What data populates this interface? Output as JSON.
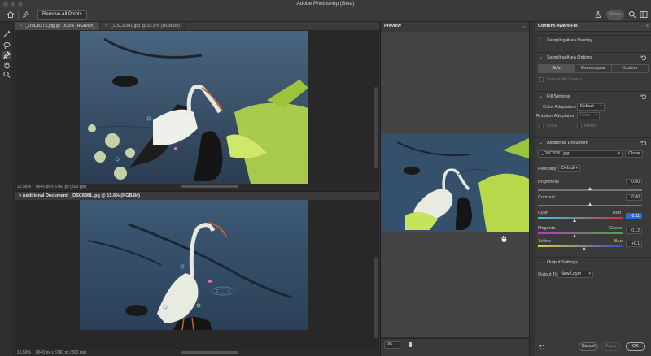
{
  "app": {
    "title": "Adobe Photoshop (Beta)"
  },
  "options_bar": {
    "remove_all_points": "Remove All Points",
    "share": "Share",
    "home_icon": "home-icon",
    "pin_icon": "pin-icon",
    "search_icon": "search-icon"
  },
  "tabs": [
    {
      "label": "_DSC8372.jpg @ 15.6% (RGB/8#)",
      "close": "×",
      "active": true
    },
    {
      "label": "_DSC8381.jpg @ 32.8% (RGB/8#)",
      "close": "×",
      "active": false
    }
  ],
  "top_status": {
    "zoom": "15.56%",
    "dims": "8640 px x 5760 px (300 ppi)"
  },
  "additional_document_bar": {
    "close": "×",
    "label": "Additional Document: _DSC8381.jpg @ 15.6% (RGB/8#)"
  },
  "bottom_status": {
    "zoom": "15.59%",
    "dims": "8640 px x 5760 px (300 ppi)"
  },
  "preview": {
    "title": "Preview",
    "zoom": "9%",
    "zoom_fraction": 0.03,
    "grip": "≡"
  },
  "content_aware_fill": {
    "title": "Content-Aware Fill",
    "grip": "≡",
    "sampling_area_overlay": {
      "label": "Sampling Area Overlay",
      "chevron": "›"
    },
    "sampling_area_options": {
      "label": "Sampling Area Options",
      "chevron": "⌄",
      "modes": [
        "Auto",
        "Rectangular",
        "Custom"
      ],
      "selected_mode": "Auto",
      "sample_all_layers": "Sample All Layers"
    },
    "fill_settings": {
      "label": "Fill Settings",
      "chevron": "⌄",
      "color_adaptation_label": "Color Adaptation",
      "color_adaptation_value": "Default",
      "rotation_adaptation_label": "Rotation Adaptation",
      "rotation_adaptation_value": "None",
      "scale": "Scale",
      "mirror": "Mirror"
    },
    "additional_document": {
      "label": "Additional Document",
      "chevron": "⌄",
      "file": "_DSC8381.jpg",
      "close": "Close",
      "flexibility_label": "Flexibility",
      "flexibility_value": "Default",
      "brightness_label": "Brightness",
      "brightness_value": "0.00",
      "brightness_fraction": 0.5,
      "contrast_label": "Contrast",
      "contrast_value": "0.00",
      "contrast_fraction": 0.5,
      "cyan_label": "Cyan",
      "red_label": "Red",
      "cyan_red_value": "-0.11",
      "cyan_red_fraction": 0.44,
      "magenta_label": "Magenta",
      "green_label": "Green",
      "magenta_green_value": "-0.12",
      "magenta_green_fraction": 0.44,
      "yellow_label": "Yellow",
      "blue_label": "Blue",
      "yellow_blue_value": "+0.1",
      "yellow_blue_fraction": 0.55
    },
    "output_settings": {
      "label": "Output Settings",
      "chevron": "⌄",
      "output_to_label": "Output To",
      "output_to_value": "New Layer"
    },
    "buttons": {
      "cancel": "Cancel",
      "apply": "Apply",
      "ok": "OK"
    }
  },
  "colors": {
    "accent": "#2a6ad4",
    "panel": "#3a3a3a",
    "canvas": "#282828",
    "water": "#36506b"
  }
}
